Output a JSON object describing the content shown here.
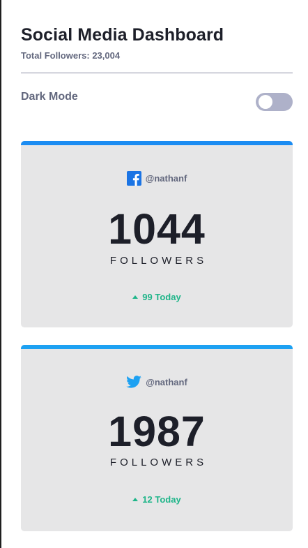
{
  "header": {
    "title": "Social Media Dashboard",
    "total_followers": "Total Followers: 23,004"
  },
  "settings": {
    "dark_mode_label": "Dark Mode",
    "dark_mode_enabled": false
  },
  "colors": {
    "facebook_bar": "#1b8cf2",
    "twitter_bar": "#1da1f2",
    "positive": "#1eb589",
    "card_bg": "#e6e6e7"
  },
  "cards": [
    {
      "platform_icon": "facebook-icon",
      "handle": "@nathanf",
      "count": "1044",
      "label": "FOLLOWERS",
      "today": "99 Today",
      "trend": "up"
    },
    {
      "platform_icon": "twitter-icon",
      "handle": "@nathanf",
      "count": "1987",
      "label": "FOLLOWERS",
      "today": "12 Today",
      "trend": "up"
    }
  ]
}
